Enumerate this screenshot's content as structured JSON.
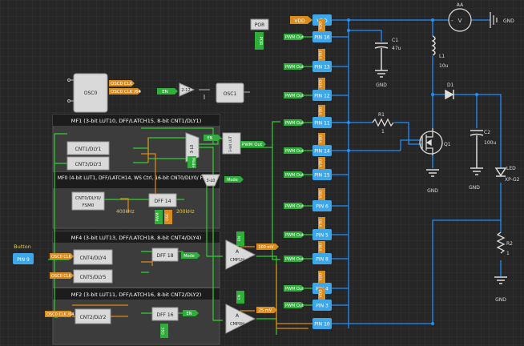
{
  "colors": {
    "bg": "#262626",
    "grid": "#343434",
    "blue": "#1e90ff",
    "green": "#2fcf2f",
    "orange": "#e08a10",
    "pin": "#3ea7ea",
    "tagGreen": "#2fae3a",
    "tagOrange": "#d98b1e",
    "panel": "#3c3c3c",
    "panelHead": "#1c1c1c",
    "block": "#d9d9d9"
  },
  "power": {
    "vdd_tag": "VDD",
    "vdd_pin": "VDD",
    "supply": "AA",
    "supply_symbol": "V",
    "gnd": "GND"
  },
  "por": {
    "label": "POR",
    "tag": "POR"
  },
  "osc": {
    "osc0": "OSC0",
    "osc0_out1": "OSC0 CLK",
    "osc0_out2": "OSC0 CLK /64",
    "osc1": "OSC1",
    "en": "EN",
    "div": "2-12"
  },
  "pins_right": [
    {
      "pin": "PIN 16",
      "tag": "PWM Out",
      "vdd": "VDD"
    },
    {
      "pin": "PIN 13",
      "tag": "PWM Out",
      "vdd": "VDD"
    },
    {
      "pin": "PIN 12",
      "tag": "PWM Out",
      "vdd": "VDD"
    },
    {
      "pin": "PIN 11",
      "tag": "PWM Out",
      "vdd": "VDD"
    },
    {
      "pin": "PIN 14",
      "tag": "PWM Out",
      "vdd": "VDD"
    },
    {
      "pin": "PIN 15",
      "tag": "PWM Out",
      "vdd": "VDD"
    },
    {
      "pin": "PIN 6",
      "tag": "PWM Out",
      "vdd": "VDD"
    },
    {
      "pin": "PIN 5",
      "tag": "PWM Out",
      "vdd": "VDD"
    },
    {
      "pin": "PIN 8",
      "tag": "PWM Out",
      "vdd": "VDD"
    },
    {
      "pin": "PIN 4",
      "tag": "PWM Out",
      "vdd": "VDD"
    },
    {
      "pin": "PIN 3",
      "tag": "PWM Out",
      "vdd": "VDD"
    },
    {
      "pin": "PIN 10",
      "tag": "",
      "vdd": ""
    }
  ],
  "mf1": {
    "title": "MF1 (3-bit LUT10, DFF/LATCH15, 8-bit CNT1/DLY1)",
    "cnt1": "CNT1/DLY1",
    "cnt3": "CNT3/DLY3",
    "lut": "3-L0",
    "mode": "Mode"
  },
  "mf0": {
    "title": "MF0 (4-bit LUT1, DFF/LATCH14, WS Ctrl, 16-bit CNT0/DLY0/ FSM0)",
    "cnt0a": "CNT0/DLY0/",
    "cnt0b": "FSM0",
    "dff": "DFF 14",
    "f1": "400kHz",
    "f2": "200kHz",
    "pwm": "PWM",
    "osc": "OSC"
  },
  "mf4": {
    "title": "MF4 (3-bit LUT13, DFF/LATCH18, 8-bit CNT4/DLY4)",
    "cnt4": "CNT4/DLY4",
    "cnt5": "CNT5/DLY5",
    "dff": "DFF 18",
    "mode": "Mode"
  },
  "mf2": {
    "title": "MF2 (3-bit LUT11, DFF/LATCH16, 8-bit CNT2/DLY2)",
    "cnt2": "CNT2/DLY2",
    "dff": "DFF 16",
    "en": "EN",
    "osc": "OSC"
  },
  "lut_top": {
    "label": "3-bit LUT",
    "en": "EN",
    "pwm": "PWM Out"
  },
  "lut_mid": {
    "label": "3-L0",
    "mode": "Mode"
  },
  "cmp1": {
    "a": "A",
    "name": "CMP1H",
    "ref": "100 mV",
    "en": "EN"
  },
  "cmp0": {
    "a": "A",
    "name": "CMP0H",
    "ref": "25 mV",
    "en": "EN"
  },
  "button": {
    "label": "Button",
    "pin": "PIN 9",
    "clk1": "OSC0 CLK",
    "clk2": "OSC0 CLK",
    "clk3": "OSC0 CLK /64"
  },
  "c1": {
    "name": "C1",
    "value": "47u"
  },
  "l1": {
    "name": "L1",
    "value": "10u"
  },
  "d1": {
    "name": "D1"
  },
  "r1": {
    "name": "R1",
    "value": "1"
  },
  "q1": {
    "name": "Q1"
  },
  "c2": {
    "name": "C2",
    "value": "100u"
  },
  "led": {
    "name": "LED",
    "value": "XP-G2"
  },
  "r2": {
    "name": "R2",
    "value": "1"
  }
}
